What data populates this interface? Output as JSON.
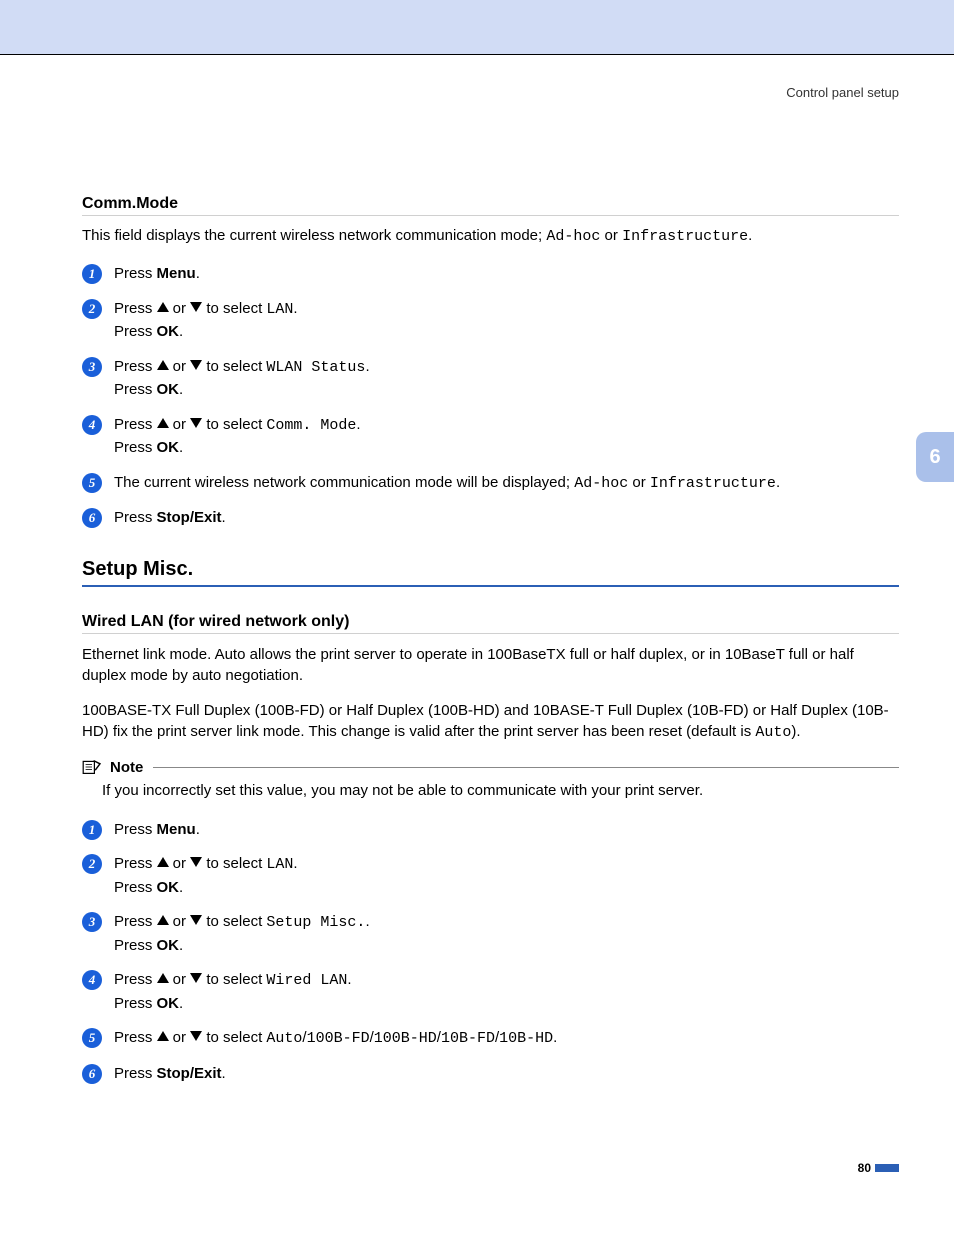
{
  "header": {
    "right": "Control panel setup"
  },
  "sideTab": "6",
  "pageNumber": "80",
  "commMode": {
    "heading": "Comm.Mode",
    "intro_pre": "This field displays the current wireless network communication mode; ",
    "intro_m1": "Ad-hoc",
    "intro_mid": " or ",
    "intro_m2": "Infrastructure",
    "intro_post": ".",
    "steps": {
      "s1": {
        "press": "Press ",
        "menu": "Menu",
        "post": "."
      },
      "s2": {
        "pre": "Press ",
        "mid": " or ",
        "sel": " to select ",
        "val": "LAN",
        "post": ".",
        "l2a": "Press ",
        "ok": "OK",
        "l2b": "."
      },
      "s3": {
        "pre": "Press ",
        "mid": " or ",
        "sel": " to select ",
        "val": "WLAN Status",
        "post": ".",
        "l2a": "Press ",
        "ok": "OK",
        "l2b": "."
      },
      "s4": {
        "pre": "Press ",
        "mid": " or ",
        "sel": " to select ",
        "val": "Comm. Mode",
        "post": ".",
        "l2a": "Press ",
        "ok": "OK",
        "l2b": "."
      },
      "s5": {
        "pre": "The current wireless network communication mode will be displayed; ",
        "m1": "Ad-hoc",
        "mid": " or ",
        "m2": "Infrastructure",
        "post": "."
      },
      "s6": {
        "pre": "Press ",
        "btn": "Stop/Exit",
        "post": "."
      }
    }
  },
  "setupMisc": {
    "heading": "Setup Misc.",
    "wired_heading": "Wired LAN (for wired network only)",
    "para1": "Ethernet link mode. Auto allows the print server to operate in 100BaseTX full or half duplex, or in 10BaseT full or half duplex mode by auto negotiation.",
    "para2_pre": "100BASE-TX Full Duplex (100B-FD) or Half Duplex (100B-HD) and 10BASE-T Full Duplex (10B-FD) or Half Duplex (10B-HD) fix the print server link mode. This change is valid after the print server has been reset (default is ",
    "para2_mono": "Auto",
    "para2_post": ").",
    "note_label": "Note",
    "note_body": "If you incorrectly set this value, you may not be able to communicate with your print server.",
    "steps": {
      "s1": {
        "press": "Press ",
        "menu": "Menu",
        "post": "."
      },
      "s2": {
        "pre": "Press ",
        "mid": " or ",
        "sel": " to select ",
        "val": "LAN",
        "post": ".",
        "l2a": "Press ",
        "ok": "OK",
        "l2b": "."
      },
      "s3": {
        "pre": "Press ",
        "mid": " or ",
        "sel": " to select ",
        "val": "Setup Misc.",
        "post": ".",
        "l2a": "Press ",
        "ok": "OK",
        "l2b": "."
      },
      "s4": {
        "pre": "Press ",
        "mid": " or ",
        "sel": " to select ",
        "val": "Wired LAN",
        "post": ".",
        "l2a": "Press ",
        "ok": "OK",
        "l2b": "."
      },
      "s5": {
        "pre": "Press ",
        "mid": " or ",
        "sel": " to select ",
        "v1": "Auto",
        "v2": "100B-FD",
        "v3": "100B-HD",
        "v4": "10B-FD",
        "v5": "10B-HD",
        "slash": "/",
        "post": "."
      },
      "s6": {
        "pre": "Press ",
        "btn": "Stop/Exit",
        "post": "."
      }
    }
  }
}
